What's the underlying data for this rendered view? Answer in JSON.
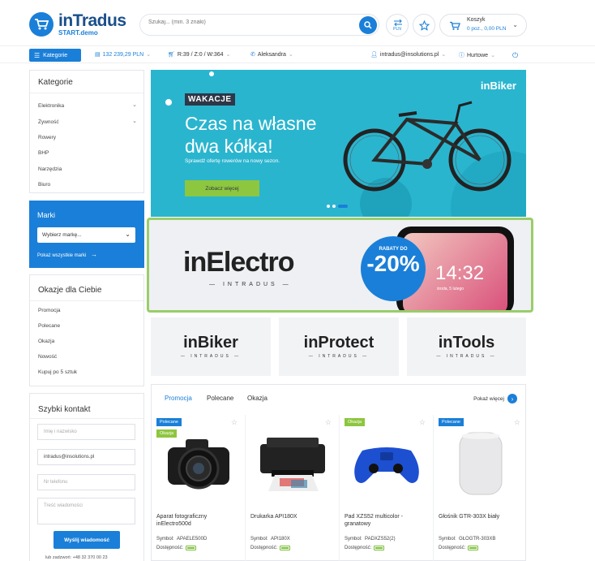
{
  "header": {
    "logo_main": "inTradus",
    "logo_sub": "START.demo",
    "search_placeholder": "Szukaj... (min. 3 znaki)",
    "currency_label": "PLN",
    "cart": {
      "title": "Koszyk",
      "info": "0 poz., 0,00 PLN"
    }
  },
  "topbar": {
    "categories_label": "Kategorie",
    "limit": "132 239,29 PLN",
    "orders": "R:39 / Z:0 / W:364",
    "user": "Aleksandra",
    "email": "intradus@insolutions.pl",
    "pricing": "Hurtowe"
  },
  "sidebar": {
    "categories_title": "Kategorie",
    "categories": [
      {
        "label": "Elektronika",
        "expandable": true
      },
      {
        "label": "Żywność",
        "expandable": true
      },
      {
        "label": "Rowery",
        "expandable": false
      },
      {
        "label": "BHP",
        "expandable": false
      },
      {
        "label": "Narzędzia",
        "expandable": false
      },
      {
        "label": "Biuro",
        "expandable": false
      }
    ],
    "brands_title": "Marki",
    "brands_select": "Wybierz markę...",
    "brands_link": "Pokaż wszystkie marki",
    "offers_title": "Okazje dla Ciebie",
    "offers": [
      "Promocja",
      "Polecane",
      "Okazja",
      "Nowość",
      "Kupuj po 5 sztuk"
    ],
    "contact_title": "Szybki kontakt",
    "contact_name_placeholder": "Imię i nazwisko",
    "contact_email_value": "intradus@insolutions.pl",
    "contact_phone_placeholder": "Nr telefonu",
    "contact_message_placeholder": "Treść wiadomości",
    "contact_send": "Wyślij wiadomość",
    "contact_footer": "lub zadzwoń: +48 32 370 00 23"
  },
  "banner": {
    "tag": "WAKACJE",
    "title_line1": "Czas na własne",
    "title_line2": "dwa kółka!",
    "subtitle": "Sprawdź ofertę rowerów na nowy sezon.",
    "button": "Zobacz więcej",
    "brand": "inBiker"
  },
  "promo": {
    "logo": "inElectro",
    "logo_sub": "— INTRADUS —",
    "discount_top": "RABATY DO",
    "discount_value": "-20%",
    "phone_time": "14:32",
    "phone_date": "środa, 5 lutego"
  },
  "brands": [
    {
      "name": "inBiker",
      "sub": "— INTRADUS —"
    },
    {
      "name": "inProtect",
      "sub": "— INTRADUS —"
    },
    {
      "name": "inTools",
      "sub": "— INTRADUS —"
    }
  ],
  "products_section": {
    "tabs": [
      "Promocja",
      "Polecane",
      "Okazja"
    ],
    "show_more": "Pokaż więcej",
    "symbol_label": "Symbol:",
    "availability_label": "Dostępność:",
    "items": [
      {
        "badges": [
          "Polecane",
          "Okazja"
        ],
        "name": "Aparat fotograficzny inElectro500d",
        "symbol": "APAELE500D"
      },
      {
        "badges": [],
        "name": "Drukarka API180X",
        "symbol": "API180X"
      },
      {
        "badges": [
          "Okazja"
        ],
        "name": "Pad XZS52 multicolor - granatowy",
        "symbol": "PADXZS52(2)"
      },
      {
        "badges": [
          "Polecane"
        ],
        "name": "Głośnik GTR-303X biały",
        "symbol": "GŁOGTR-303XB"
      }
    ]
  },
  "colors": {
    "primary": "#1a7fd8",
    "banner": "#2ab5cf",
    "okazja": "#8dc63f",
    "highlight": "#9bcc6a"
  }
}
